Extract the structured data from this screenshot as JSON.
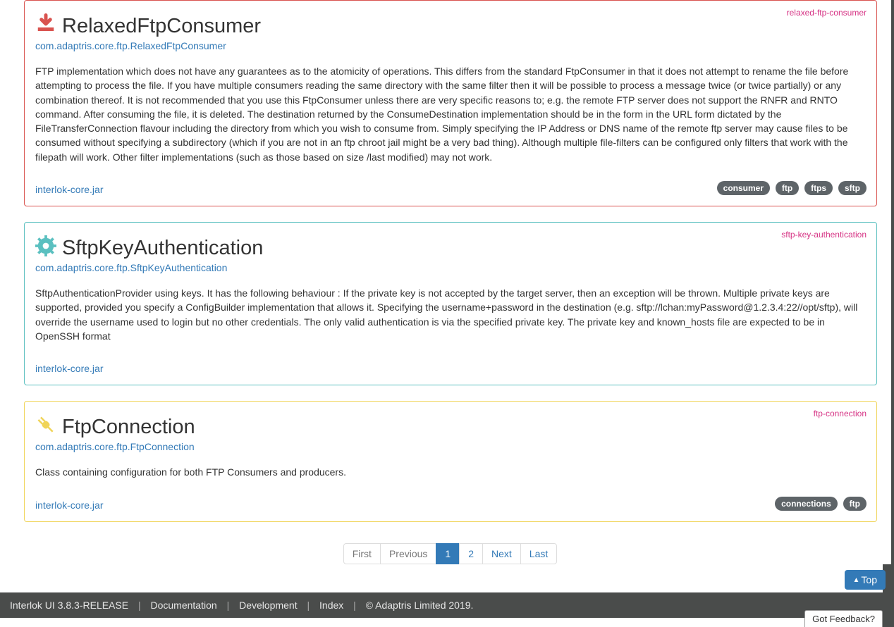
{
  "components": [
    {
      "slug": "relaxed-ftp-consumer",
      "title": "RelaxedFtpConsumer",
      "classname": "com.adaptris.core.ftp.RelaxedFtpConsumer",
      "description": "FTP implementation which does not have any guarantees as to the atomicity of operations. This differs from the standard FtpConsumer in that it does not attempt to rename the file before attempting to process the file. If you have multiple consumers reading the same directory with the same filter then it will be possible to process a message twice (or twice partially) or any combination thereof. It is not recommended that you use this FtpConsumer unless there are very specific reasons to; e.g. the remote FTP server does not support the RNFR and RNTO command. After consuming the file, it is deleted. The destination returned by the ConsumeDestination implementation should be in the form in the URL form dictated by the FileTransferConnection flavour including the directory from which you wish to consume from. Simply specifying the IP Address or DNS name of the remote ftp server may cause files to be consumed without specifying a subdirectory (which if you are not in an ftp chroot jail might be a very bad thing). Although multiple file-filters can be configured only filters that work with the filepath will work. Other filter implementations (such as those based on size /last modified) may not work.",
      "jar": "interlok-core.jar",
      "tags": [
        "consumer",
        "ftp",
        "ftps",
        "sftp"
      ],
      "color": "red",
      "icon": "download"
    },
    {
      "slug": "sftp-key-authentication",
      "title": "SftpKeyAuthentication",
      "classname": "com.adaptris.core.ftp.SftpKeyAuthentication",
      "description": "SftpAuthenticationProvider using keys. It has the following behaviour : If the private key is not accepted by the target server, then an exception will be thrown. Multiple private keys are supported, provided you specify a ConfigBuilder implementation that allows it. Specifying the username+password in the destination (e.g. sftp://lchan:myPassword@1.2.3.4:22//opt/sftp), will override the username used to login but no other credentials. The only valid authentication is via the specified private key. The private key and known_hosts file are expected to be in OpenSSH format",
      "jar": "interlok-core.jar",
      "tags": [],
      "color": "teal",
      "icon": "gear"
    },
    {
      "slug": "ftp-connection",
      "title": "FtpConnection",
      "classname": "com.adaptris.core.ftp.FtpConnection",
      "description": "Class containing configuration for both FTP Consumers and producers.",
      "jar": "interlok-core.jar",
      "tags": [
        "connections",
        "ftp"
      ],
      "color": "yellow",
      "icon": "plug"
    }
  ],
  "pagination": {
    "first": "First",
    "previous": "Previous",
    "pages": [
      "1",
      "2"
    ],
    "current": "1",
    "next": "Next",
    "last": "Last"
  },
  "top_button": "Top",
  "footer": {
    "product": "Interlok UI  3.8.3-RELEASE",
    "documentation": "Documentation",
    "development": "Development",
    "index": "Index",
    "copyright": "© Adaptris Limited 2019."
  },
  "feedback": "Got Feedback?"
}
